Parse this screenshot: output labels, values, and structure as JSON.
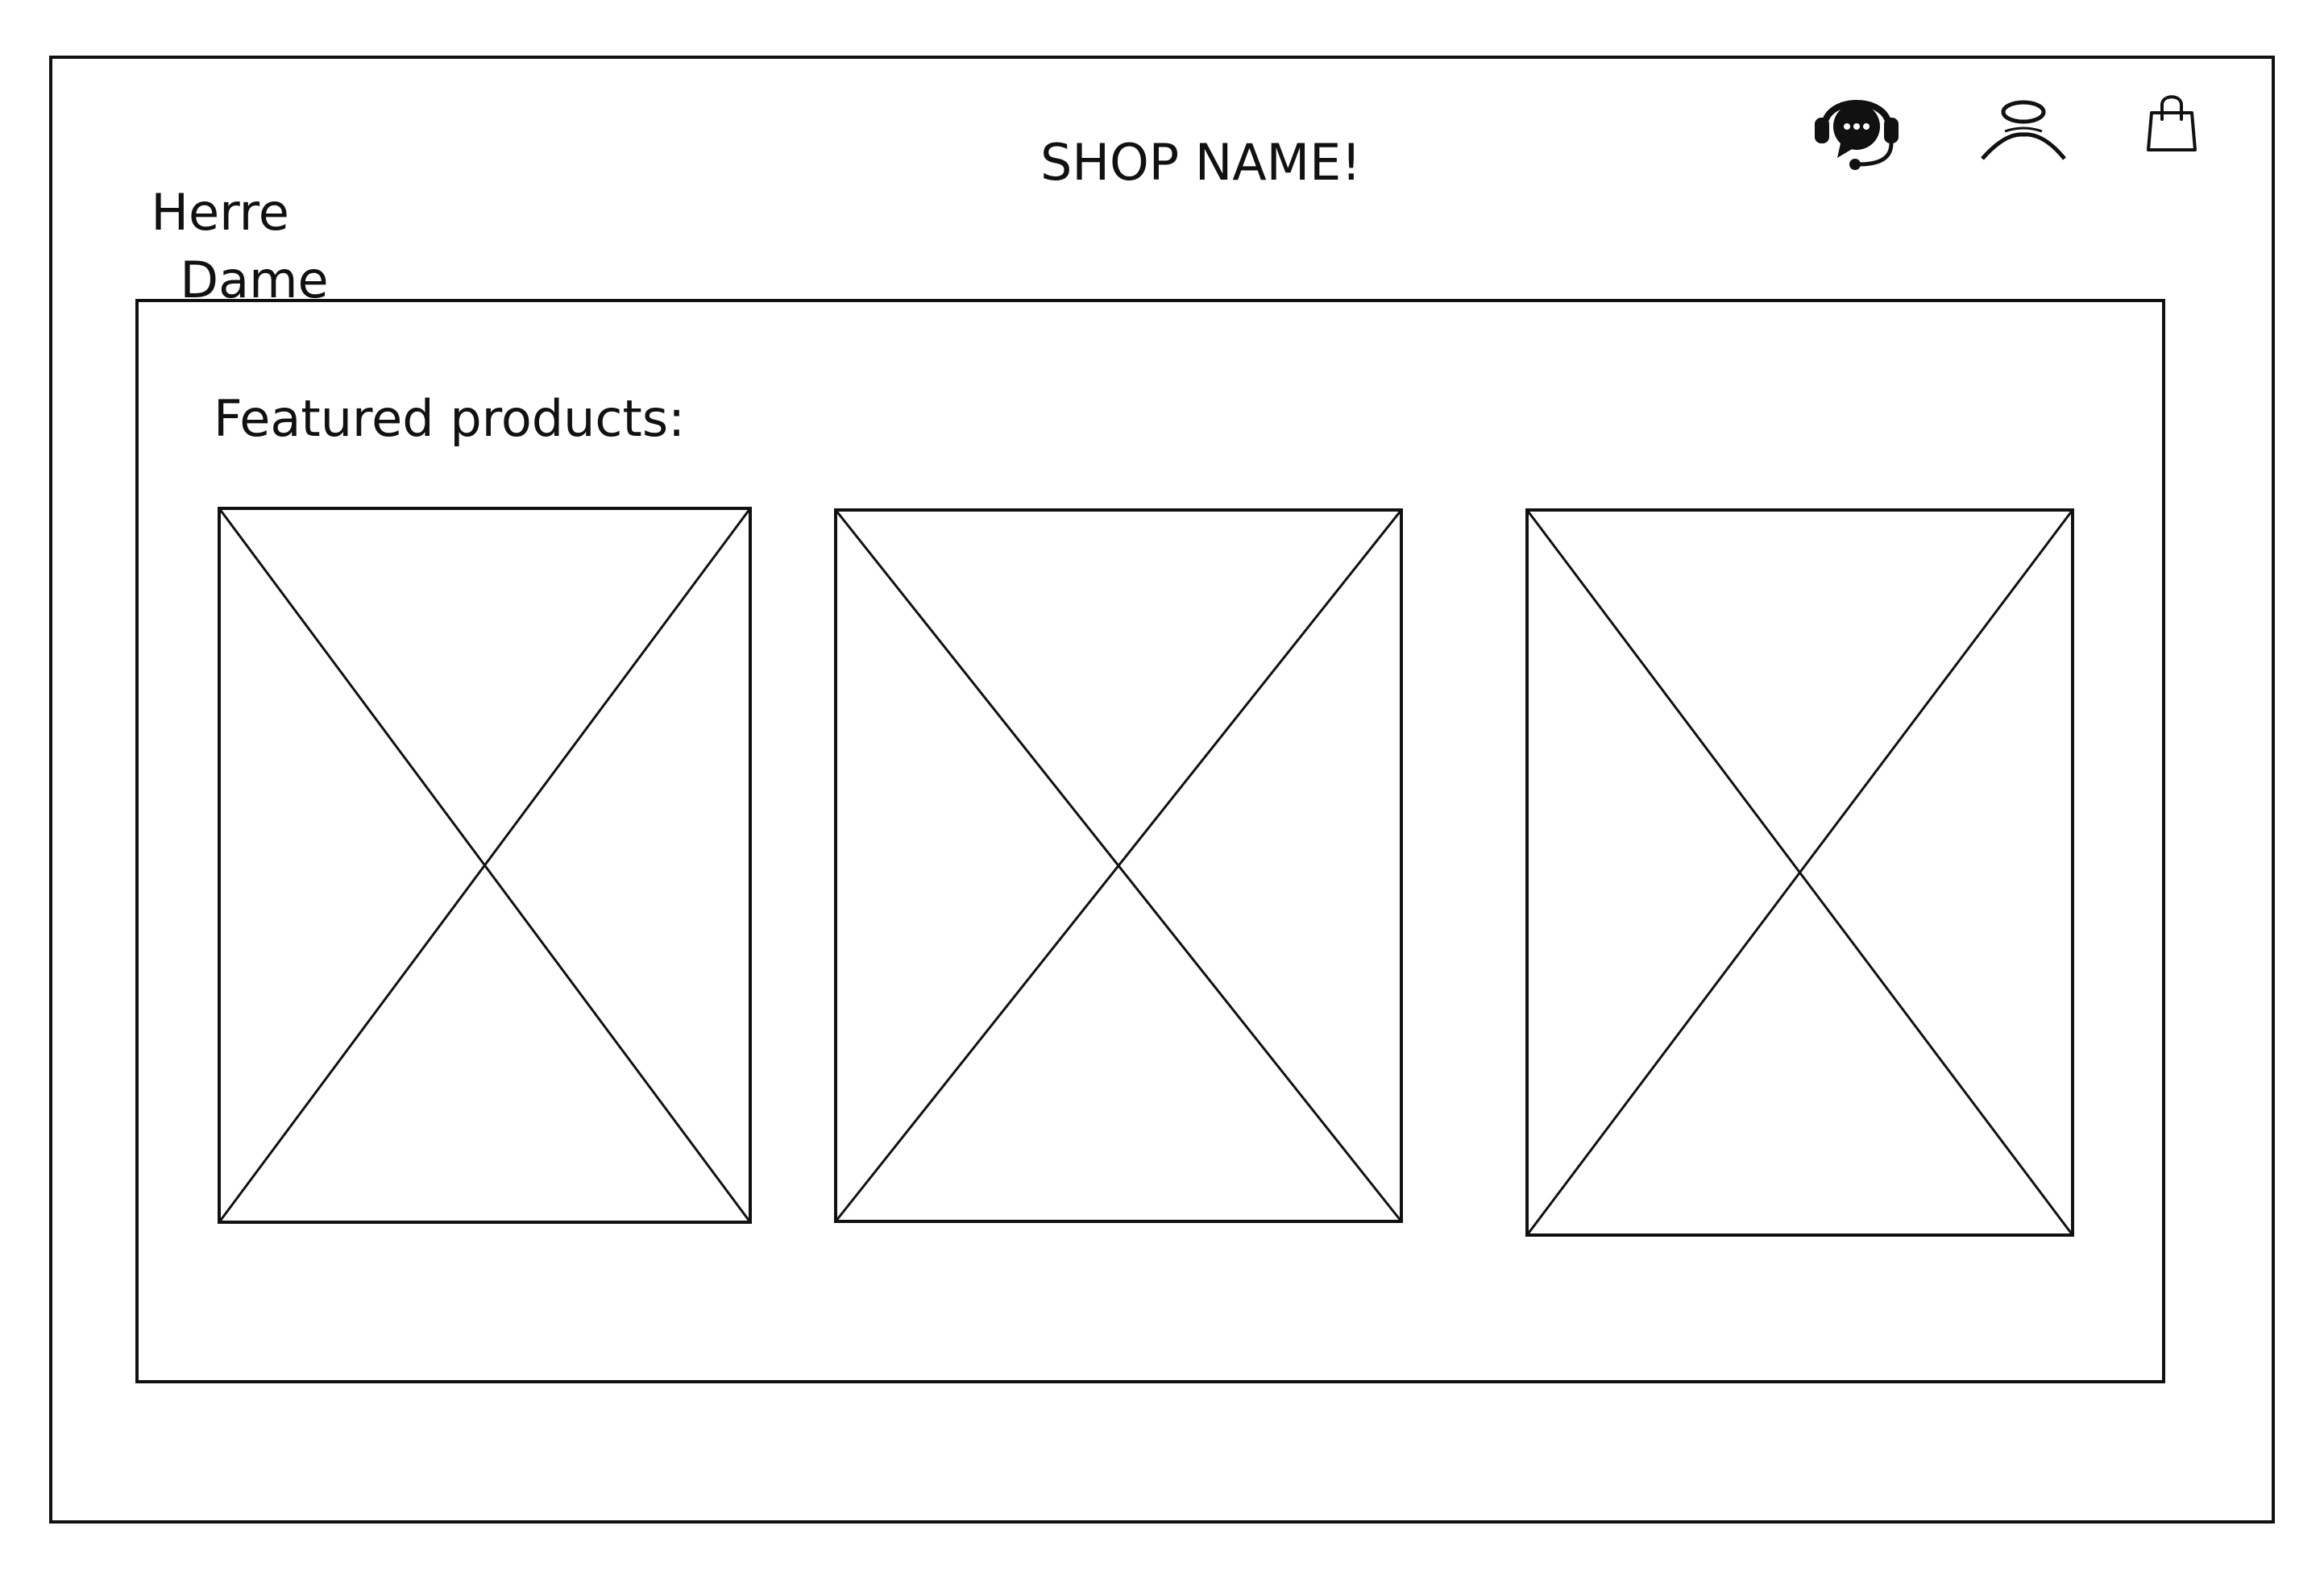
{
  "header": {
    "nav_links": [
      "Herre",
      "Dame"
    ],
    "shop_name": "SHOP NAME!",
    "icons": [
      "support-chat-icon",
      "account-icon",
      "shopping-bag-icon"
    ]
  },
  "featured": {
    "heading": "Featured products:",
    "products": [
      {
        "image": "image-placeholder"
      },
      {
        "image": "image-placeholder"
      },
      {
        "image": "image-placeholder"
      }
    ]
  }
}
